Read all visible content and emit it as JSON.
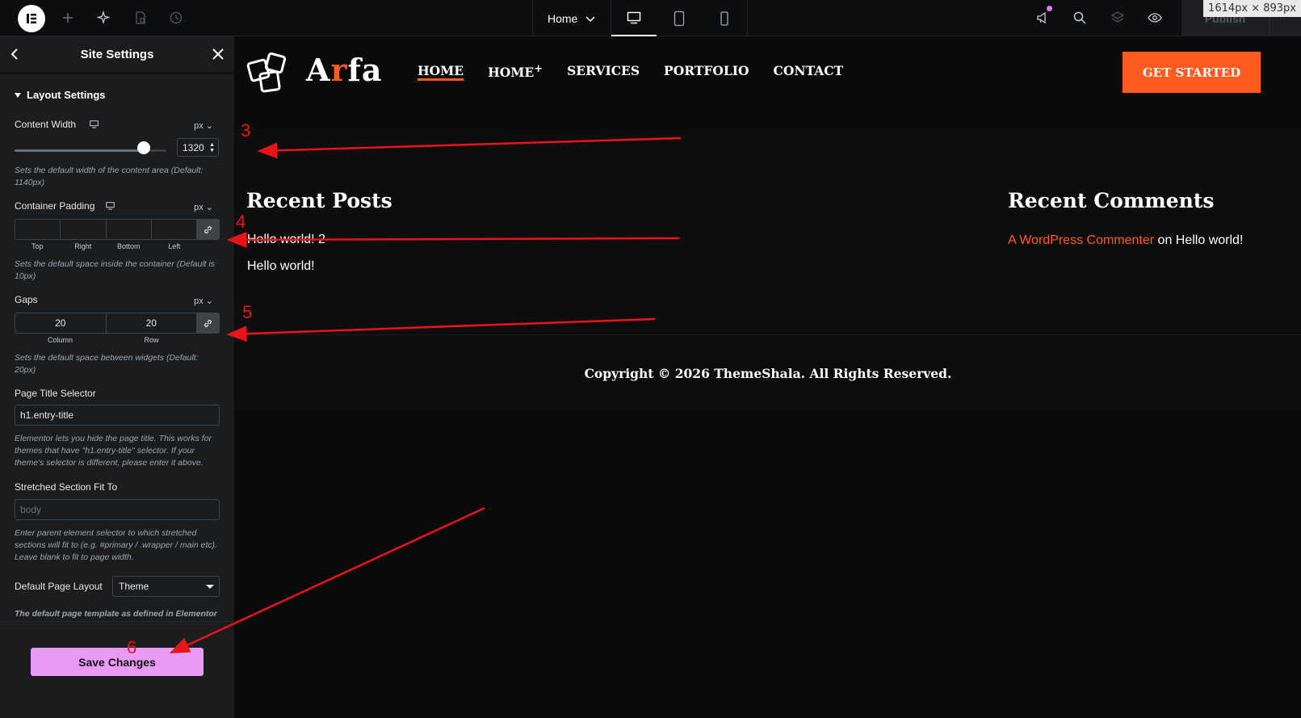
{
  "topbar": {
    "document_title": "Home",
    "publish_label": "Publish",
    "dimension_label": "1614px × 893px",
    "icons": [
      "elementor-logo-icon",
      "add-icon",
      "ai-icon",
      "page-settings-icon",
      "history-icon",
      "desktop-icon",
      "tablet-icon",
      "mobile-icon",
      "announcements-icon",
      "search-icon",
      "structure-icon",
      "preview-icon",
      "chevron-down-icon"
    ]
  },
  "panel": {
    "title": "Site Settings",
    "section_title": "Layout Settings",
    "content_width": {
      "label": "Content Width",
      "unit": "px",
      "value": "1320",
      "slider_fraction": 0.85,
      "description": "Sets the default width of the content area (Default: 1140px)"
    },
    "container_padding": {
      "label": "Container Padding",
      "unit": "px",
      "values": [
        "",
        "",
        "",
        ""
      ],
      "captions": [
        "Top",
        "Right",
        "Bottom",
        "Left"
      ],
      "description": "Sets the default space inside the container (Default is 10px)"
    },
    "gaps": {
      "label": "Gaps",
      "unit": "px",
      "column": "20",
      "row": "20",
      "captions": [
        "Column",
        "Row"
      ],
      "description": "Sets the default space between widgets (Default: 20px)"
    },
    "page_title_selector": {
      "label": "Page Title Selector",
      "value": "h1.entry-title",
      "description": "Elementor lets you hide the page title. This works for themes that have \"h1.entry-title\" selector. If your theme's selector is different, please enter it above."
    },
    "stretched_section": {
      "label": "Stretched Section Fit To",
      "placeholder": "body",
      "description": "Enter parent element selector to which stretched sections will fit to (e.g. #primary / .wrapper / main etc). Leave blank to fit to page width."
    },
    "default_page_layout": {
      "label": "Default Page Layout",
      "value": "Theme",
      "description": "The default page template as defined in Elementor"
    },
    "save_label": "Save Changes"
  },
  "site": {
    "brand_prefix": "A",
    "brand_accent": "r",
    "brand_suffix": "fa",
    "nav": [
      "HOME",
      "HOME",
      "SERVICES",
      "PORTFOLIO",
      "CONTACT"
    ],
    "nav_plus": "+",
    "cta_label": "GET STARTED",
    "recent_posts_title": "Recent Posts",
    "posts": [
      "Hello world! 2",
      "Hello world!"
    ],
    "recent_comments_title": "Recent Comments",
    "comment_author": "A WordPress Commenter",
    "comment_on": "on",
    "comment_post": "Hello world!",
    "copyright": "Copyright © 2026 ThemeShala. All Rights Reserved.",
    "accent_color": "#ff5a1f"
  },
  "annotations": [
    "3",
    "4",
    "5",
    "6"
  ],
  "colors": {
    "save_button": "#e99af5",
    "annotation": "#e8141a"
  }
}
